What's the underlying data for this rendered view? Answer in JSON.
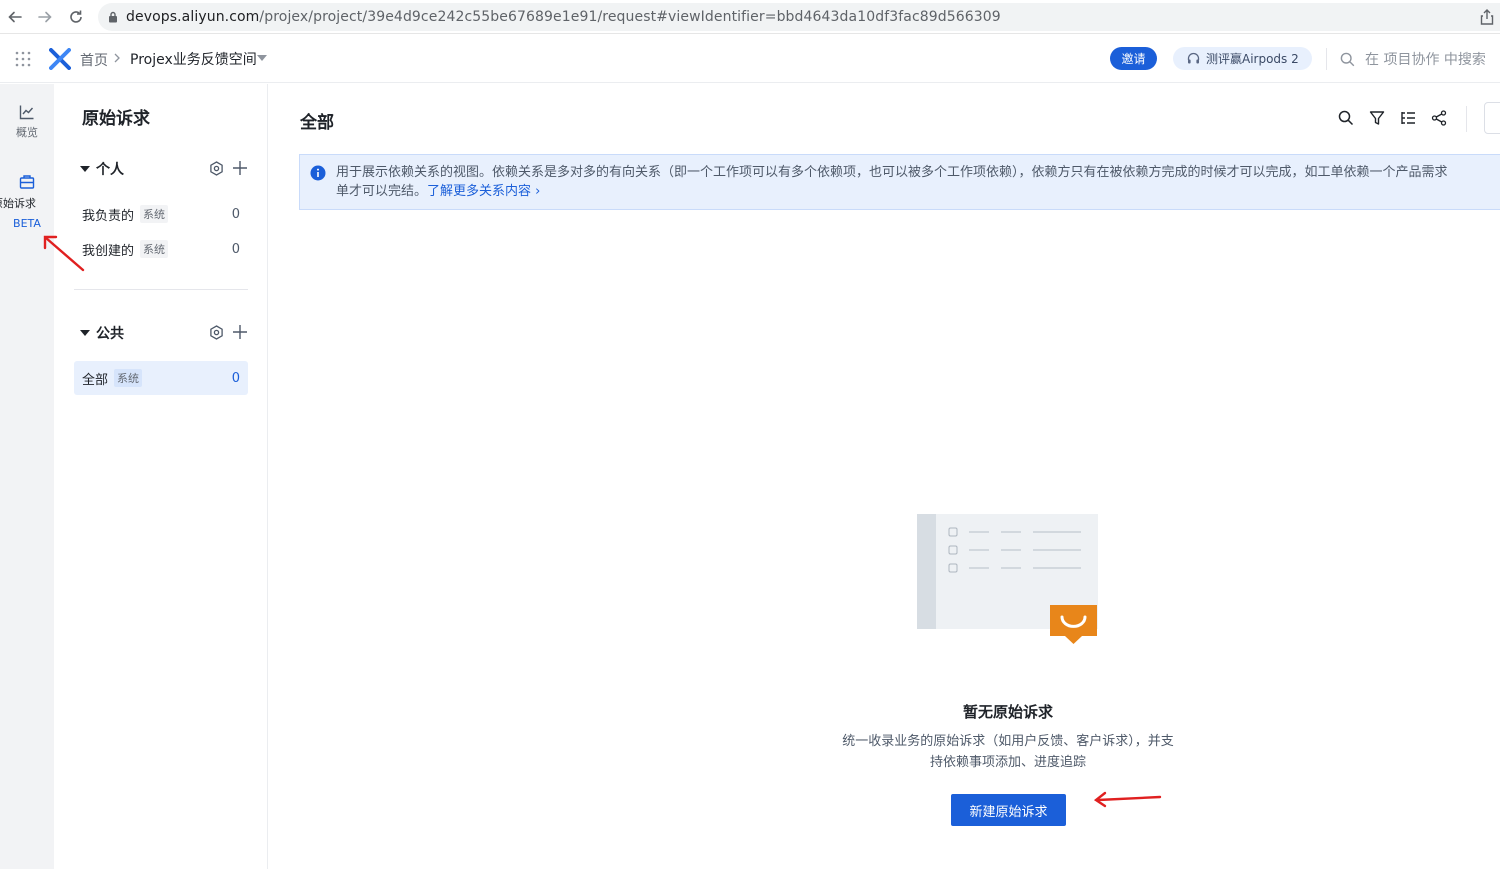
{
  "browser": {
    "url_host": "devops.aliyun.com",
    "url_path": "/projex/project/39e4d9ce242c55be67689e1e91/request#viewIdentifier=bbd4643da10df3fac89d566309"
  },
  "header": {
    "breadcrumb_home": "首页",
    "breadcrumb_current": "Projex业务反馈空间",
    "invite_label": "邀请",
    "promo_label": "测评赢Airpods 2",
    "search_placeholder": "在 项目协作 中搜索"
  },
  "rail": {
    "overview_label": "概览",
    "request_label": "原始诉求",
    "beta_label": "BETA"
  },
  "sidebar": {
    "title": "原始诉求",
    "personal": {
      "label": "个人",
      "items": [
        {
          "label": "我负责的",
          "tag": "系统",
          "count": "0"
        },
        {
          "label": "我创建的",
          "tag": "系统",
          "count": "0"
        }
      ]
    },
    "public": {
      "label": "公共",
      "items": [
        {
          "label": "全部",
          "tag": "系统",
          "count": "0"
        }
      ]
    }
  },
  "main": {
    "title": "全部",
    "notice_line1": "用于展示依赖关系的视图。依赖关系是多对多的有向关系（即一个工作项可以有多个依赖项，也可以被多个工作项依赖），依赖方只有在被依赖方完成的时候才可以完成，如工单依赖一个产品需求",
    "notice_line2": "单才可以完结。",
    "notice_link": "了解更多关系内容",
    "empty_title": "暂无原始诉求",
    "empty_desc_line1": "统一收录业务的原始诉求（如用户反馈、客户诉求），并支",
    "empty_desc_line2": "持依赖事项添加、进度追踪",
    "create_button": "新建原始诉求"
  },
  "colors": {
    "primary": "#1b5fd9",
    "notice_bg": "#e8f0fd",
    "rail_bg": "#f2f3f5",
    "annotation_red": "#e02020",
    "illustration_orange": "#e8861a"
  }
}
